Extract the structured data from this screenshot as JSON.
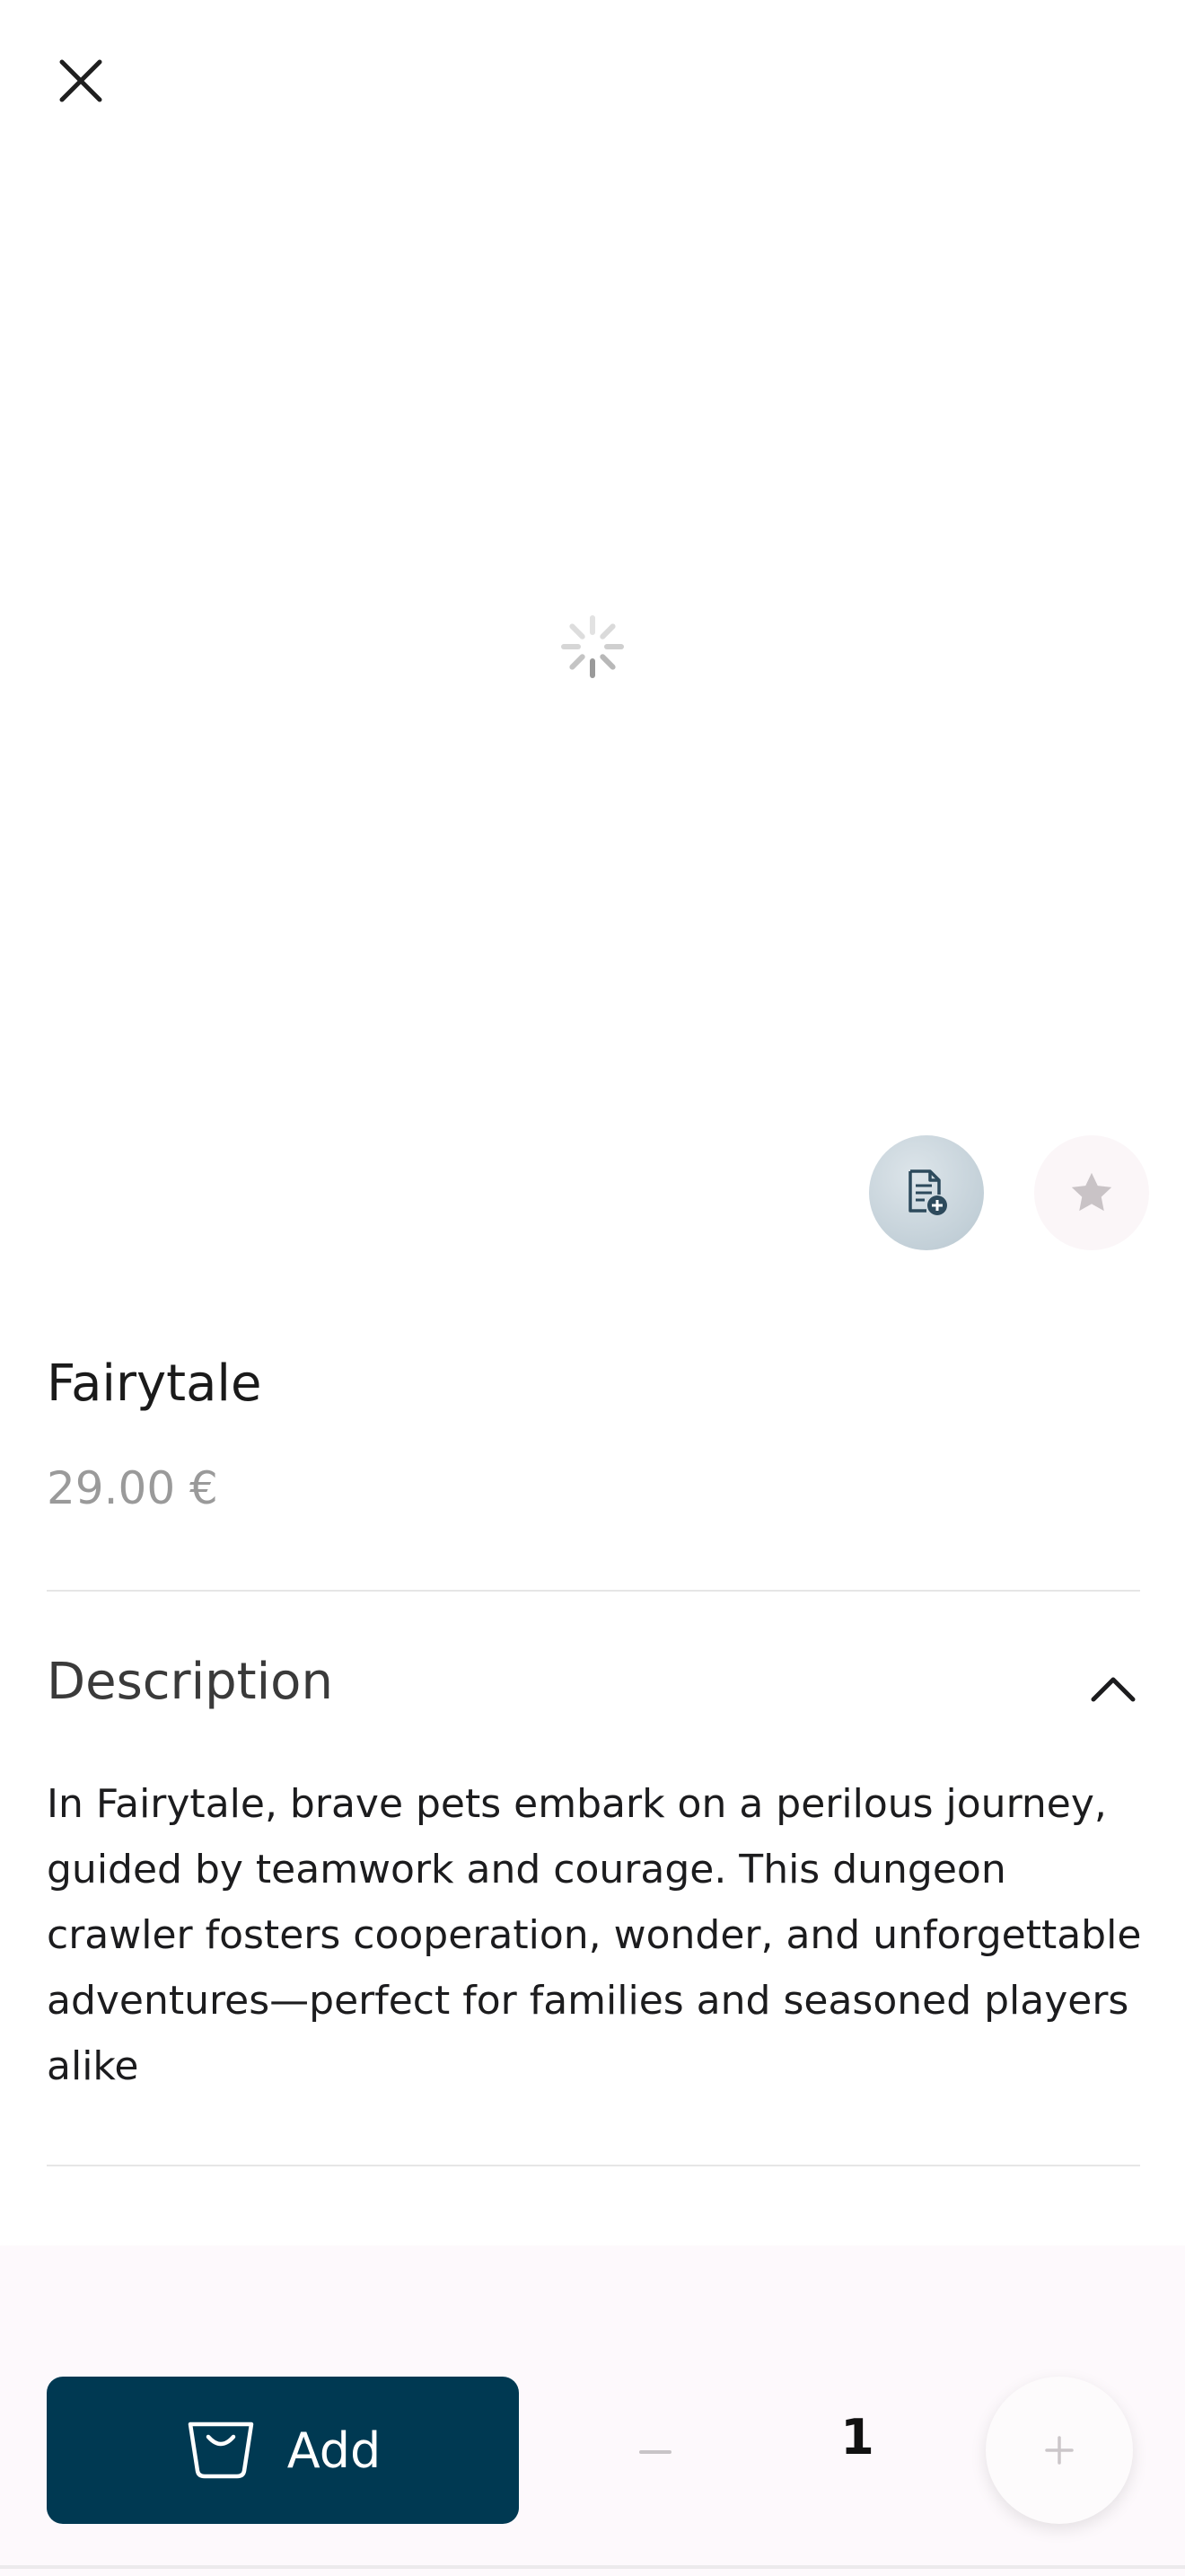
{
  "product": {
    "title": "Fairytale",
    "price": "29.00 €"
  },
  "description": {
    "title": "Description",
    "text": "In Fairytale, brave pets embark on a perilous journey, guided by teamwork and courage. This dungeon crawler fosters cooperation, wonder, and unforgettable adventures—perfect for families and seasoned players alike",
    "expanded": true
  },
  "cart": {
    "add_label": "Add",
    "quantity": "1"
  },
  "icons": {
    "close": "close-icon",
    "loading": "loading-spinner-icon",
    "document": "add-document-icon",
    "favorite": "star-icon",
    "collapse": "chevron-up-icon",
    "bag": "shopping-bag-icon",
    "minus": "minus-icon",
    "plus": "plus-icon"
  },
  "colors": {
    "primary": "#003952",
    "price": "#9a9a9a",
    "bottom_bar": "#fdf9fc"
  }
}
